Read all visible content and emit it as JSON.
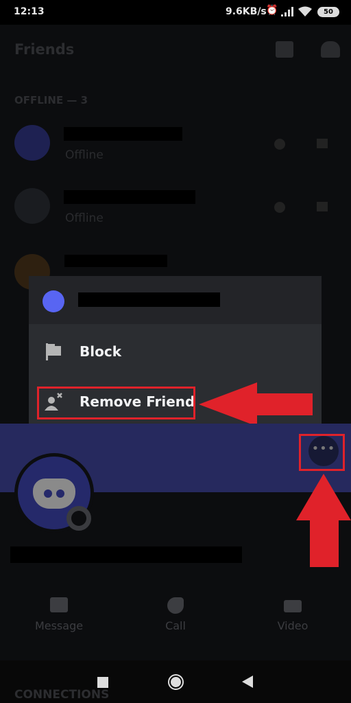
{
  "status_bar": {
    "time": "12:13",
    "net_speed": "9.6KB/s",
    "battery": "50"
  },
  "header": {
    "title": "Friends",
    "icons": [
      "new-group-dm-icon",
      "add-friend-icon"
    ]
  },
  "section": {
    "label": "OFFLINE — 3"
  },
  "friends": [
    {
      "status": "Offline"
    },
    {
      "status": "Offline"
    },
    {
      "status": ""
    }
  ],
  "menu": {
    "items": [
      {
        "label": "Block",
        "icon": "flag-icon"
      },
      {
        "label": "Remove Friend",
        "icon": "remove-friend-icon"
      }
    ]
  },
  "profile": {
    "more_icon": "ellipsis-icon"
  },
  "actions": [
    {
      "label": "Message"
    },
    {
      "label": "Call"
    },
    {
      "label": "Video"
    }
  ],
  "connections": {
    "label": "CONNECTIONS"
  },
  "colors": {
    "banner": "#26295e",
    "annotation_red": "#e0222a",
    "blurple": "#5865f2"
  }
}
